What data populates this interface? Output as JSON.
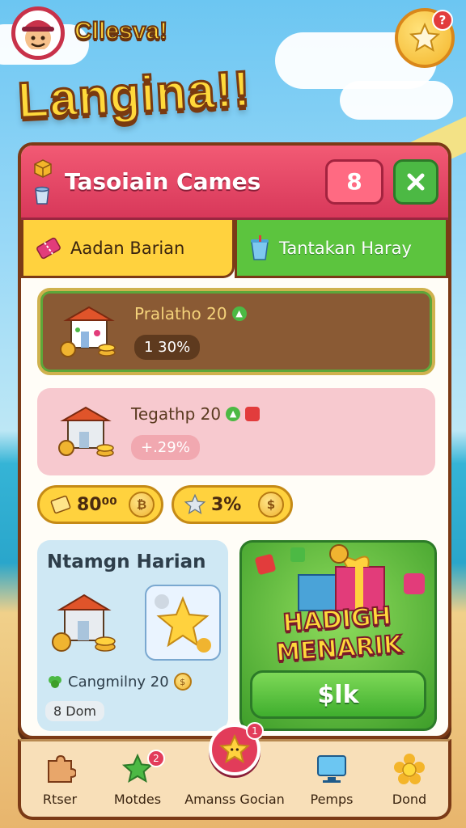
{
  "header": {
    "player_name": "Cllesva!",
    "game_title": "Langina!!",
    "star_badge": "?"
  },
  "panel": {
    "title": "Tasoiain Cames",
    "count": "8",
    "tabs": [
      {
        "label": "Aadan Barian",
        "icon": "ticket-icon"
      },
      {
        "label": "Tantakan Haray",
        "icon": "cup-icon"
      }
    ],
    "tasks": [
      {
        "title": "Pralatho 20",
        "value": "1 30%",
        "icon": "shop-building-icon"
      },
      {
        "title": "Tegathp 20",
        "value": "+.29%",
        "icon": "shop-building-icon"
      }
    ],
    "rewards": [
      {
        "value": "80⁰⁰",
        "icon": "ticket-gold-icon"
      },
      {
        "value": "3%",
        "icon": "star-icon"
      }
    ],
    "daily": {
      "title": "Ntamgn Harian",
      "subtitle": "Cangmilny 20",
      "pill": "8 Dom"
    },
    "gift": {
      "headline_1": "HADIGH",
      "headline_2": "MENARIK",
      "button_label": "$lk"
    }
  },
  "bottom_nav": [
    {
      "label": "Rtser",
      "icon": "puzzle-icon"
    },
    {
      "label": "Motdes",
      "icon": "star-icon",
      "badge": "2"
    },
    {
      "label": "Amanss Gocian",
      "icon": "star-face-icon",
      "badge": "1"
    },
    {
      "label": "Pemps",
      "icon": "monitor-icon"
    },
    {
      "label": "Dond",
      "icon": "flower-icon"
    }
  ],
  "colors": {
    "accent_pink": "#d8385a",
    "accent_green": "#4cb944",
    "accent_yellow": "#ffd23e",
    "outline_brown": "#7b3a16"
  }
}
